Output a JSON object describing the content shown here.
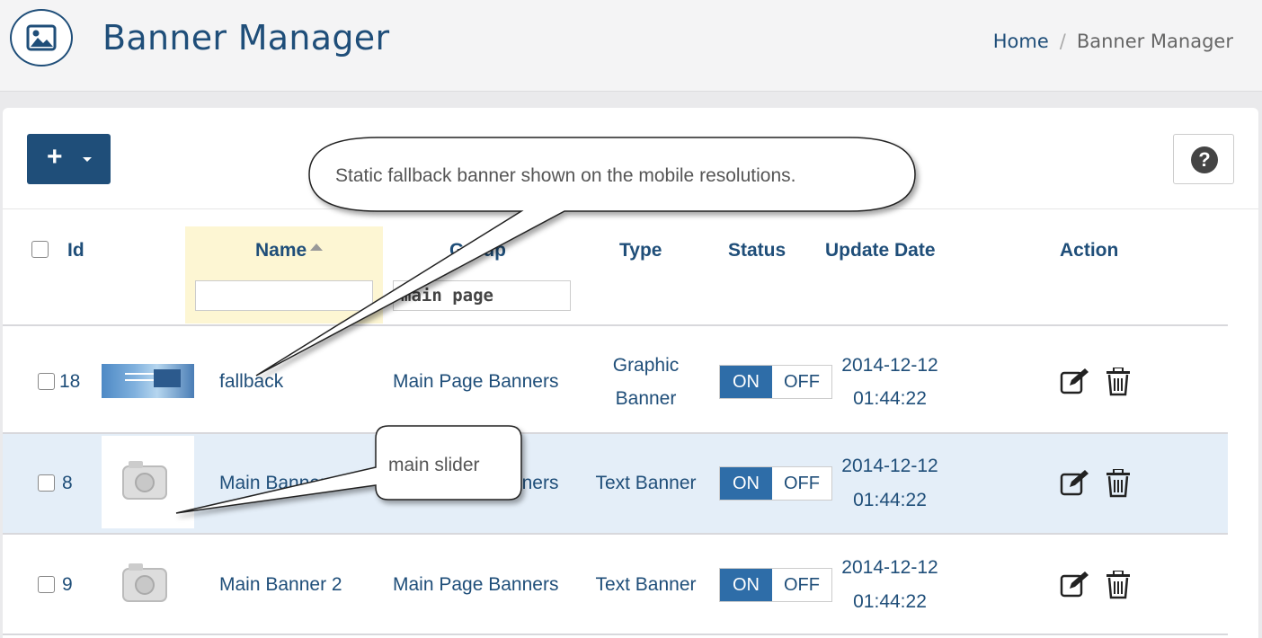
{
  "header": {
    "title": "Banner Manager",
    "breadcrumb": {
      "home": "Home",
      "separator": "/",
      "current": "Banner Manager"
    }
  },
  "toolbar": {
    "add_label": "+",
    "help_label": "?"
  },
  "table": {
    "columns": {
      "id": "Id",
      "name": "Name",
      "group": "Group",
      "type": "Type",
      "status": "Status",
      "update_date": "Update Date",
      "action": "Action"
    },
    "filters": {
      "name": "",
      "group": "main page"
    },
    "rows": [
      {
        "id": "18",
        "name": "fallback",
        "group": "Main Page Banners",
        "type_line1": "Graphic",
        "type_line2": "Banner",
        "on": "ON",
        "off": "OFF",
        "date": "2014-12-12",
        "time": "01:44:22"
      },
      {
        "id": "8",
        "name": "Main Banner 1",
        "group": "Main Page Banners",
        "type_line1": "Text Banner",
        "type_line2": "",
        "on": "ON",
        "off": "OFF",
        "date": "2014-12-12",
        "time": "01:44:22"
      },
      {
        "id": "9",
        "name": "Main Banner 2",
        "group": "Main Page Banners",
        "type_line1": "Text Banner",
        "type_line2": "",
        "on": "ON",
        "off": "OFF",
        "date": "2014-12-12",
        "time": "01:44:22"
      }
    ]
  },
  "callouts": {
    "fallback_note": "Static fallback banner shown on the mobile resolutions.",
    "slider_note": "main slider"
  },
  "colors": {
    "brand": "#1f4e79",
    "toggle_on": "#2e6da8",
    "selected_row": "#e4eef8",
    "sorted_column": "#fdf6d3"
  }
}
